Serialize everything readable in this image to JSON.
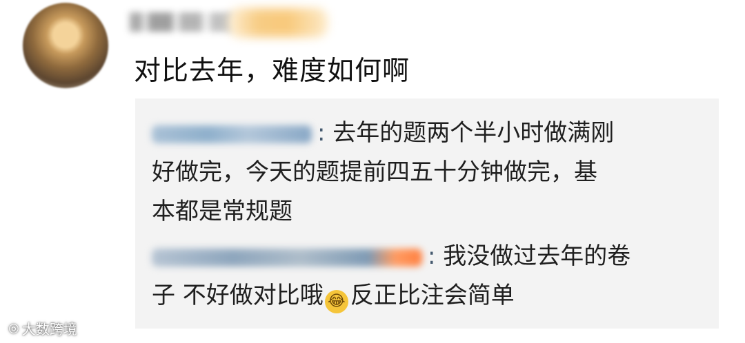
{
  "comment": {
    "text": "对比去年，难度如何啊"
  },
  "replies": [
    {
      "separator": ":",
      "text_line1": " 去年的题两个半小时做满刚",
      "text_line2": "好做完，今天的题提前四五十分钟做完，基",
      "text_line3": "本都是常规题"
    },
    {
      "separator": ":",
      "text_line1": " 我没做过去年的卷",
      "text_line2_a": "子 不好做对比哦",
      "emoji": "😂",
      "text_line2_b": "反正比注会简单"
    }
  ],
  "watermark": {
    "icon": "weibo-icon",
    "text": "大数跨境"
  }
}
